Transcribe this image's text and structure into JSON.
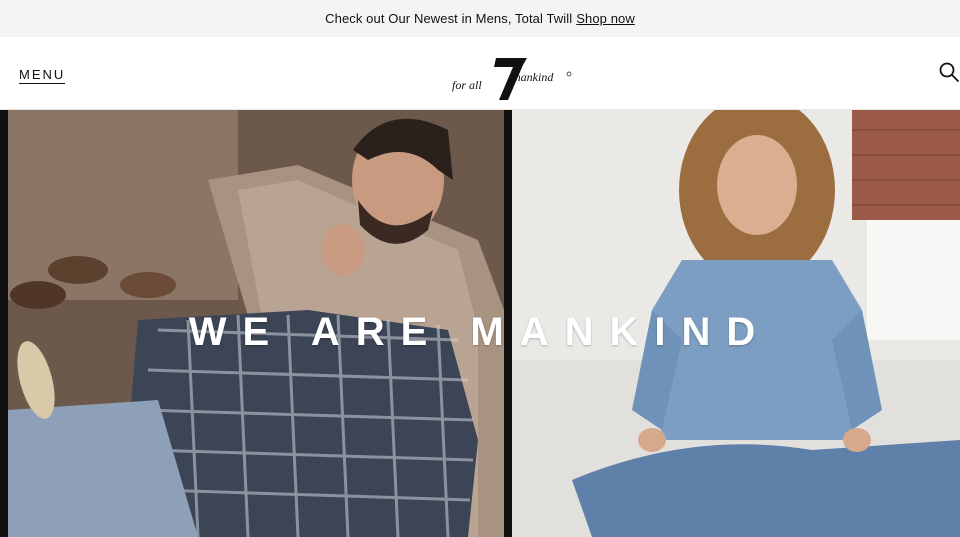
{
  "promo": {
    "text": "Check out Our Newest in Mens, Total Twill",
    "link": "Shop now"
  },
  "header": {
    "menu_label": "MENU",
    "logo_text": "for all mankind",
    "logo_mark": "7"
  },
  "hero": {
    "headline": "WE ARE MANKIND"
  },
  "icons": {
    "search": "search-icon"
  },
  "colors": {
    "text": "#111111",
    "promo_bg": "#f4f4f4"
  }
}
